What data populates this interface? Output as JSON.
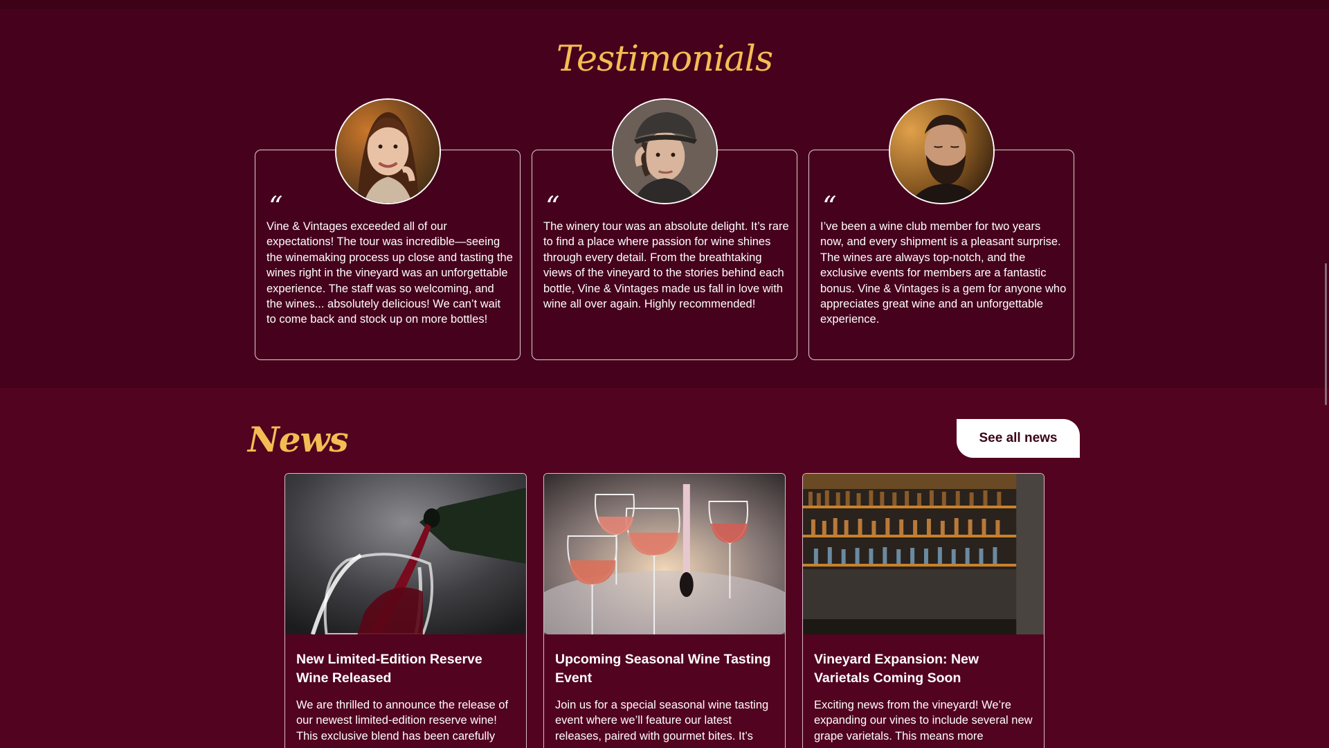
{
  "testimonials": {
    "title": "Testimonials",
    "items": [
      {
        "quote_mark": "“",
        "text": "Vine & Vintages exceeded all of our expectations! The tour was incredible—seeing the winemaking process up close and tasting the wines right in the vineyard was an unforgettable experience. The staff was so welcoming, and the wines... absolutely delicious! We can’t wait to come back and stock up on more bottles!"
      },
      {
        "quote_mark": "“",
        "text": "The winery tour was an absolute delight. It’s rare to find a place where passion for wine shines through every detail. From the breathtaking views of the vineyard to the stories behind each bottle, Vine & Vintages made us fall in love with wine all over again. Highly recommended!"
      },
      {
        "quote_mark": "“",
        "text": "I’ve been a wine club member for two years now, and every shipment is a pleasant surprise. The wines are always top-notch, and the exclusive events for members are a fantastic bonus. Vine & Vintages is a gem for anyone who appreciates great wine and an unforgettable experience."
      }
    ]
  },
  "news": {
    "title": "News",
    "see_all_label": "See all news",
    "items": [
      {
        "title": "New Limited-Edition Reserve Wine Released",
        "body": "We are thrilled to announce the release of our newest limited-edition reserve wine! This exclusive blend has been carefully"
      },
      {
        "title": "Upcoming Seasonal Wine Tasting Event",
        "body": "Join us for a special seasonal wine tasting event where we’ll feature our latest releases, paired with gourmet bites. It’s"
      },
      {
        "title": "Vineyard Expansion: New Varietals Coming Soon",
        "body": "Exciting news from the vineyard! We’re expanding our vines to include several new grape varietals. This means more"
      }
    ]
  },
  "colors": {
    "background": "#52031f",
    "testimonials_background": "#46011c",
    "accent_gold": "#f4bd54",
    "button_bg": "#ffffff",
    "button_text": "#3a0416"
  }
}
